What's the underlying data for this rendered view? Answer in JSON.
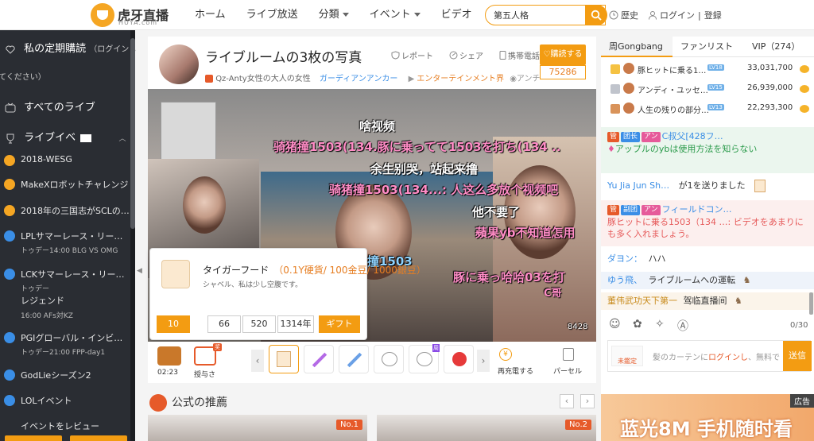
{
  "header": {
    "logo_text": "虎牙直播",
    "logo_sub": "HUYA.com",
    "nav": [
      {
        "label": "ホーム",
        "dropdown": false
      },
      {
        "label": "ライブ放送",
        "dropdown": false
      },
      {
        "label": "分類",
        "dropdown": true
      },
      {
        "label": "イベント",
        "dropdown": true
      },
      {
        "label": "ビデオ",
        "dropdown": false
      }
    ],
    "search_value": "第五人格",
    "history_label": "歴史",
    "login_label": "ログイン",
    "register_label": "登録"
  },
  "sidebar": {
    "subscriptions_title": "私の定期購読",
    "login_hint_1": "（ログインし",
    "login_hint_2": "てください）",
    "all_live": "すべてのライブ",
    "live_events": "ライブイベ",
    "items": [
      {
        "title": "2018-WESG",
        "sub": "",
        "sub2": "",
        "color": "orange"
      },
      {
        "title": "MakeXロボットチャレンジ",
        "sub": "",
        "sub2": "",
        "color": "orange"
      },
      {
        "title": "2018年の三国志がSCLの…",
        "sub": "",
        "sub2": "",
        "color": "orange"
      },
      {
        "title": "LPLサマーレース・リー…",
        "sub": "トゥデー14:00 BLG VS OMG",
        "sub2": "",
        "color": "blue"
      },
      {
        "title": "LCKサマーレース・リー…",
        "sub": "トゥデー",
        "sub2": "レジェンド",
        "sub3": "16:00 AFs対KZ",
        "color": "blue"
      },
      {
        "title": "PGIグローバル・インビ…",
        "sub": "トゥデー21:00 FPP-day1",
        "sub2": "",
        "color": "blue"
      },
      {
        "title": "GodLieシーズン2",
        "sub": "",
        "sub2": "",
        "color": "blue"
      },
      {
        "title": "LOLイベント",
        "sub": "",
        "sub2": "",
        "color": "blue"
      },
      {
        "title": "イベントをレビュー",
        "sub": "",
        "sub2": "",
        "color": "none"
      }
    ]
  },
  "room": {
    "title": "ライブルームの3枚の写真",
    "actions": [
      "レポート",
      "シェア",
      "携帯電話"
    ],
    "anchor": "Qz-Anty女性の大人の女性",
    "guardian": "ガーディアンアンカー",
    "category": "エンターテインメント界",
    "extra": "アンチ",
    "subscribe_label": "購読する",
    "subscribe_count": "75286"
  },
  "video": {
    "danmaku": [
      {
        "text": "啥视频",
        "color": "white"
      },
      {
        "text": "骑猪撞1503(134.豚に乗ってて1503を打ち(134 ..",
        "color": "pink"
      },
      {
        "text": "余生别哭，站起来撸",
        "color": "white"
      },
      {
        "text": "骑猪撞1503(134...: 人这么多放个视频吧",
        "color": "pink"
      },
      {
        "text": "他不要了",
        "color": "white"
      },
      {
        "text": "蘋果yb不知道怎用",
        "color": "pink"
      },
      {
        "text": "撞1503",
        "color": "blue"
      },
      {
        "text": "豚に乗っ哈哈03を打",
        "color": "pink"
      },
      {
        "text": "C哥",
        "color": "pink"
      },
      {
        "text": "8428",
        "color": "white"
      }
    ]
  },
  "gift_popup": {
    "name": "タイガーフード",
    "price": "（0.1Y硬貨/ 100金豆/ 1000銀豆）",
    "desc": "シャベル、私は少し空腹です。",
    "quantities": [
      "10",
      "66",
      "520",
      "1314年"
    ],
    "gift_button": "ギフト"
  },
  "giftbar": {
    "timer": "02:23",
    "award_label": "授与さ",
    "award_badge": "奖",
    "recharge_label": "再充電する",
    "parcel_label": "パーセル",
    "new_badge": "周"
  },
  "recommend": {
    "title": "公式の推薦",
    "cards": [
      {
        "badge": "No.1"
      },
      {
        "badge": "No.2"
      }
    ]
  },
  "right_panel": {
    "tabs": [
      {
        "label": "周Gongbang",
        "active": true
      },
      {
        "label": "ファンリスト",
        "active": false
      },
      {
        "label": "VIP（274）",
        "active": false
      }
    ],
    "ranking": [
      {
        "name": "豚ヒットに乗る1…",
        "level": "LV18",
        "value": "33,031,700"
      },
      {
        "name": "アンディ・ユッセ…",
        "level": "LV15",
        "value": "26,939,000"
      },
      {
        "name": "人生の残りの部分…",
        "level": "LV13",
        "value": "22,293,300"
      }
    ],
    "chat": [
      {
        "badge1": "团长",
        "badge2": "アン",
        "user": "C叔父[428フ…",
        "text": "アップルのybは使用方法を知らない"
      },
      {
        "user": "Yu Jia Jun Sh…",
        "text": "が1を送りました"
      },
      {
        "badge1": "副团",
        "badge2": "アン",
        "user": "フィールドコン…",
        "text": "豚ヒットに乗る1503（134 …: ビデオをあまりにも多く入れましょう。"
      },
      {
        "user": "ダヨン：",
        "text": "ハハ"
      },
      {
        "user": "ゆう飛、",
        "text": "ライブルームへの運転"
      },
      {
        "user": "董伟武功天下第一",
        "text": "驾临直播间"
      }
    ],
    "counter": "0/30",
    "input_placeholder_1": "髪のカーテンに",
    "input_placeholder_login": "ログインし",
    "input_placeholder_2": "、無料で",
    "not_live": "未鑑定",
    "send_label": "送信"
  },
  "ad": {
    "tag": "広告",
    "text": "蓝光8M 手机随时看"
  }
}
